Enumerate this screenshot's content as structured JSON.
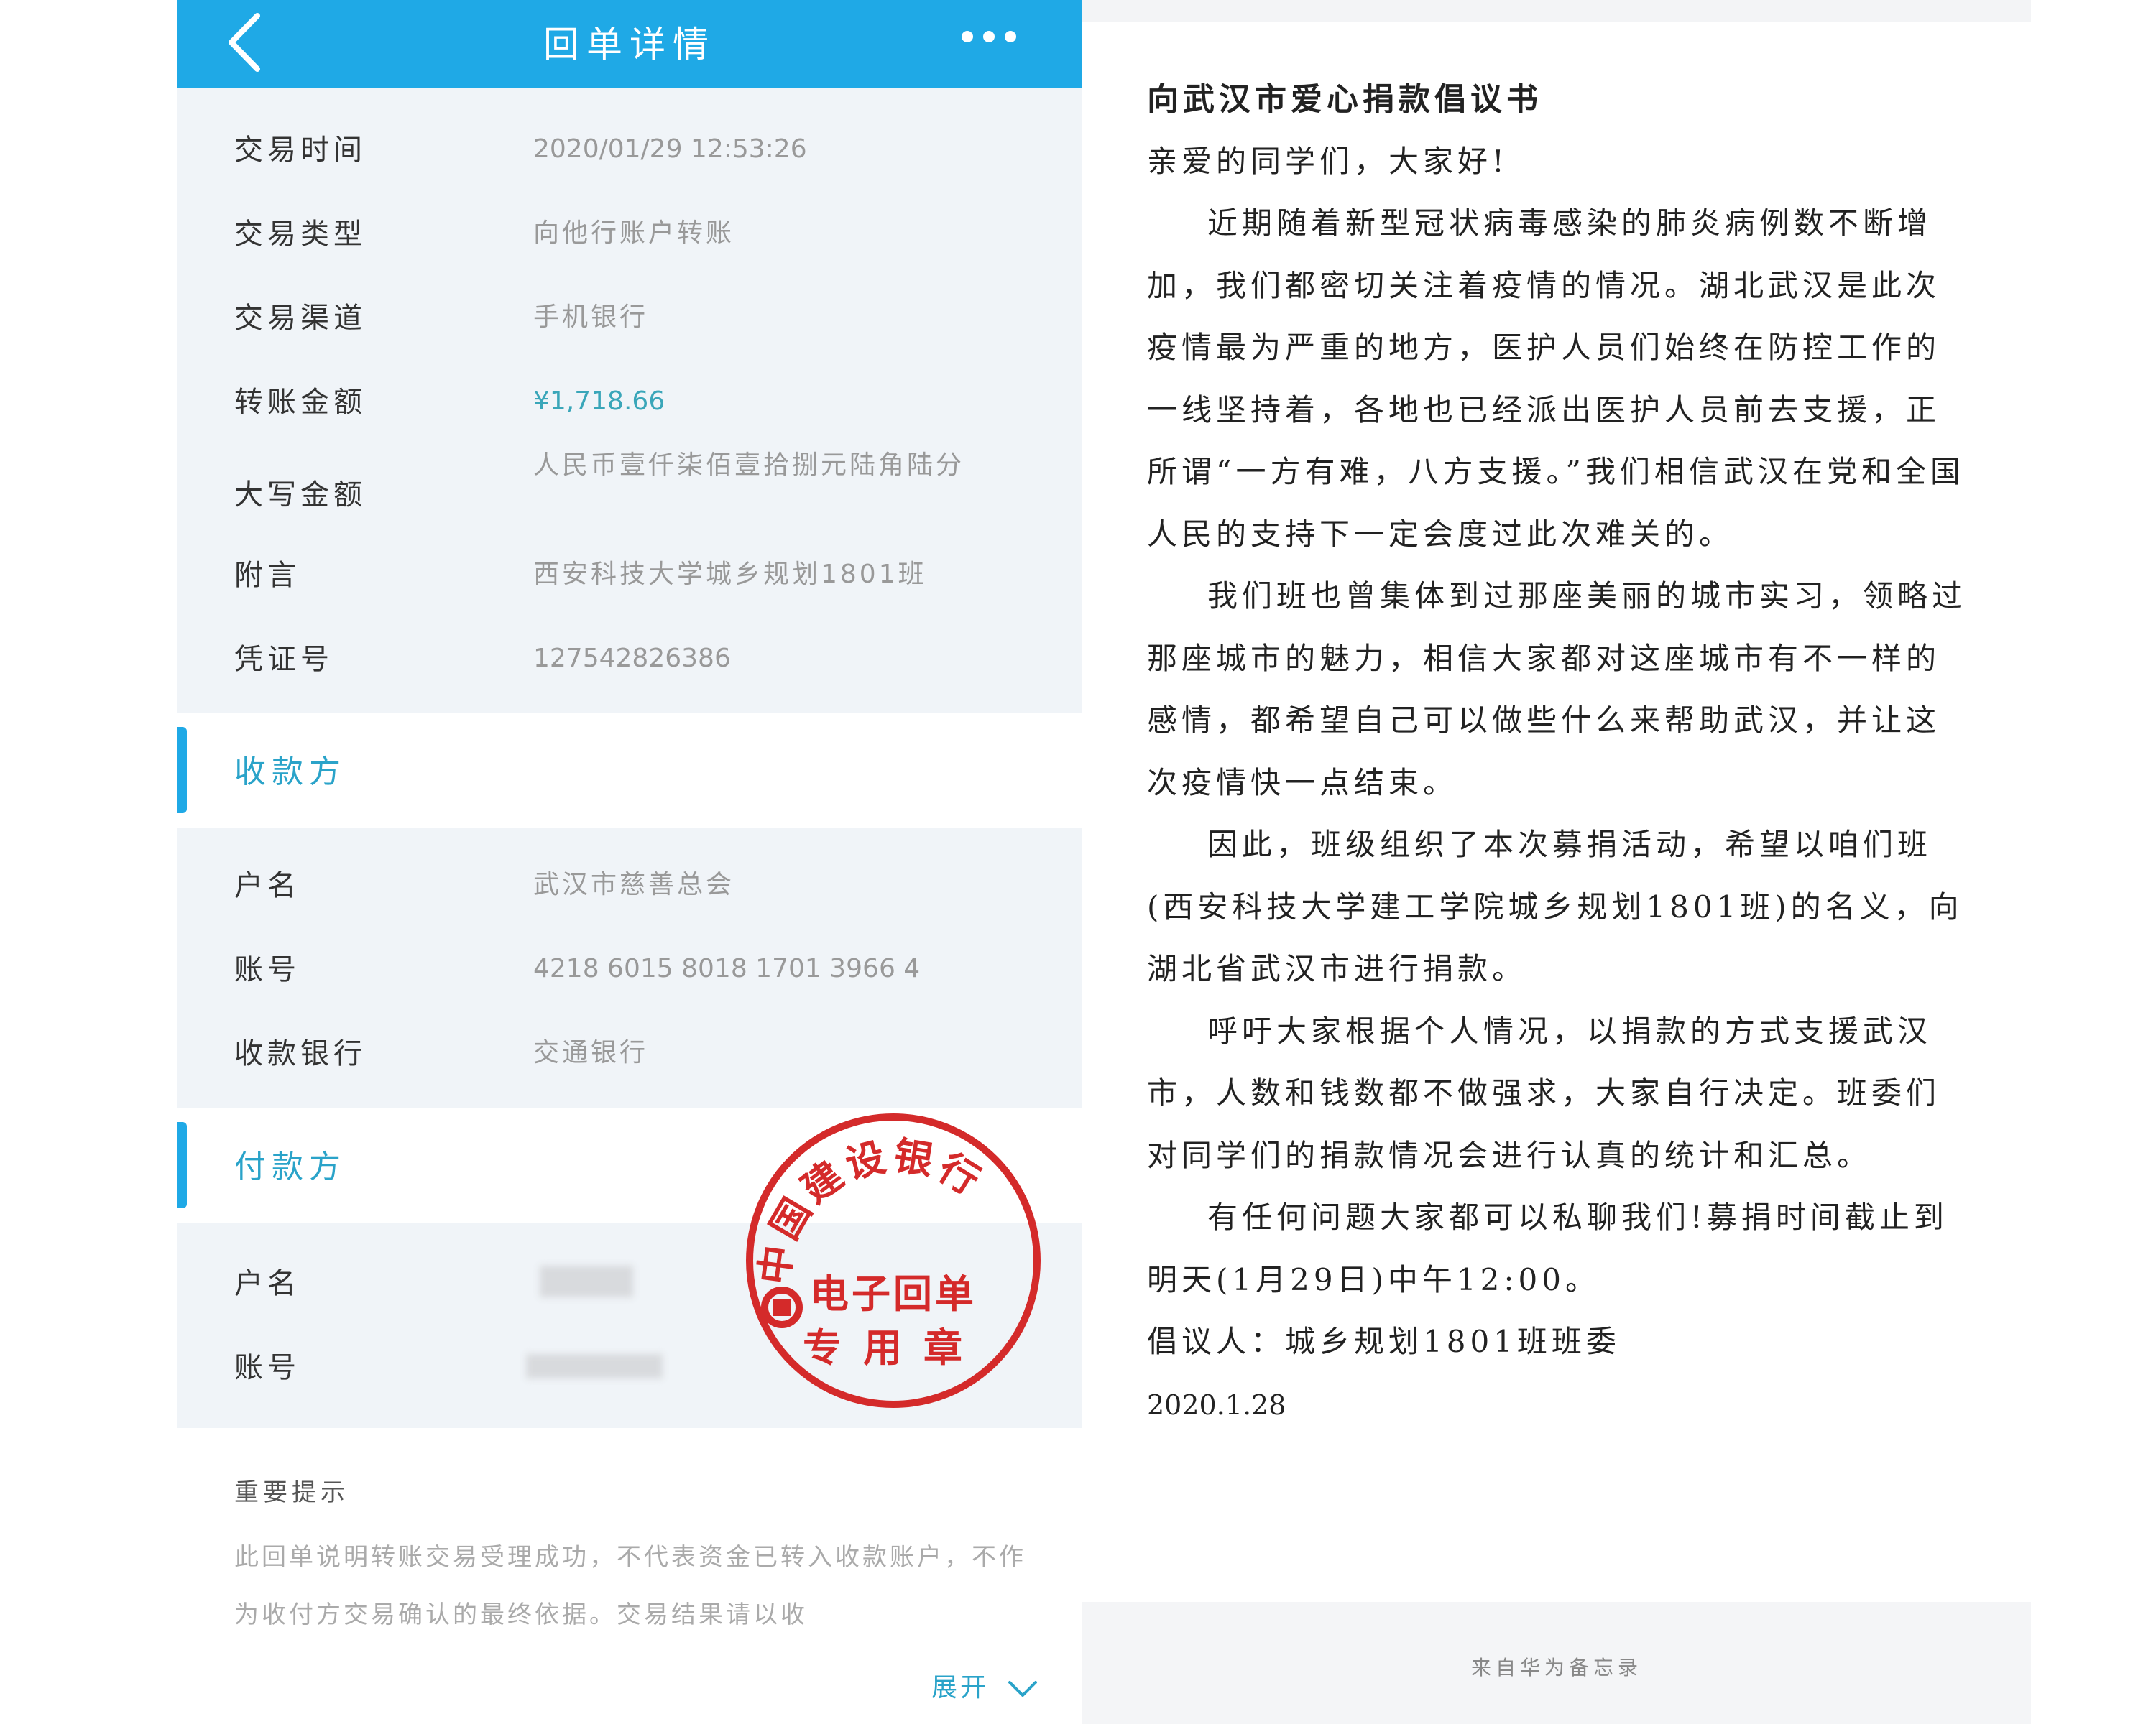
{
  "receipt": {
    "title": "回单详情",
    "transaction": [
      {
        "label": "交易时间",
        "value": "2020/01/29  12:53:26"
      },
      {
        "label": "交易类型",
        "value": "向他行账户转账"
      },
      {
        "label": "交易渠道",
        "value": "手机银行"
      },
      {
        "label": "转账金额",
        "value": "¥1,718.66"
      },
      {
        "label": "大写金额",
        "value": "人民币壹仟柒佰壹拾捌元陆角陆分"
      },
      {
        "label": "附言",
        "value": "西安科技大学城乡规划1801班"
      },
      {
        "label": "凭证号",
        "value": "127542826386"
      }
    ],
    "payee_header": "收款方",
    "payee": [
      {
        "label": "户名",
        "value": "武汉市慈善总会"
      },
      {
        "label": "账号",
        "value": "4218 6015 8018 1701 3966 4"
      },
      {
        "label": "收款银行",
        "value": "交通银行"
      }
    ],
    "payer_header": "付款方",
    "payer": [
      {
        "label": "户名"
      },
      {
        "label": "账号"
      }
    ],
    "stamp": {
      "outer": "中国建设银行",
      "line1": "电子回单",
      "line2": "专用章",
      "color": "#d42a2a"
    },
    "tip_title": "重要提示",
    "tip_body": "此回单说明转账交易受理成功，不代表资金已转入收款账户，不作为收付方交易确认的最终依据。交易结果请以收",
    "expand_label": "展开",
    "accent": "#1fa9e6"
  },
  "memo": {
    "title": "向武汉市爱心捐款倡议书",
    "greeting": "亲爱的同学们，大家好!",
    "paragraphs": [
      "近期随着新型冠状病毒感染的肺炎病例数不断增加，我们都密切关注着疫情的情况。湖北武汉是此次疫情最为严重的地方，医护人员们始终在防控工作的一线坚持着，各地也已经派出医护人员前去支援，正所谓“一方有难，八方支援。”我们相信武汉在党和全国人民的支持下一定会度过此次难关的。",
      "我们班也曾集体到过那座美丽的城市实习，领略过那座城市的魅力，相信大家都对这座城市有不一样的感情，都希望自己可以做些什么来帮助武汉，并让这次疫情快一点结束。",
      "因此，班级组织了本次募捐活动，希望以咱们班(西安科技大学建工学院城乡规划1801班)的名义，向湖北省武汉市进行捐款。",
      "呼吁大家根据个人情况，以捐款的方式支援武汉市，人数和钱数都不做强求，大家自行决定。班委们对同学们的捐款情况会进行认真的统计和汇总。",
      "有任何问题大家都可以私聊我们!募捐时间截止到明天(1月29日)中午12:00。"
    ],
    "signature": "倡议人：城乡规划1801班班委",
    "date": "2020.1.28",
    "footer": "来自华为备忘录"
  }
}
